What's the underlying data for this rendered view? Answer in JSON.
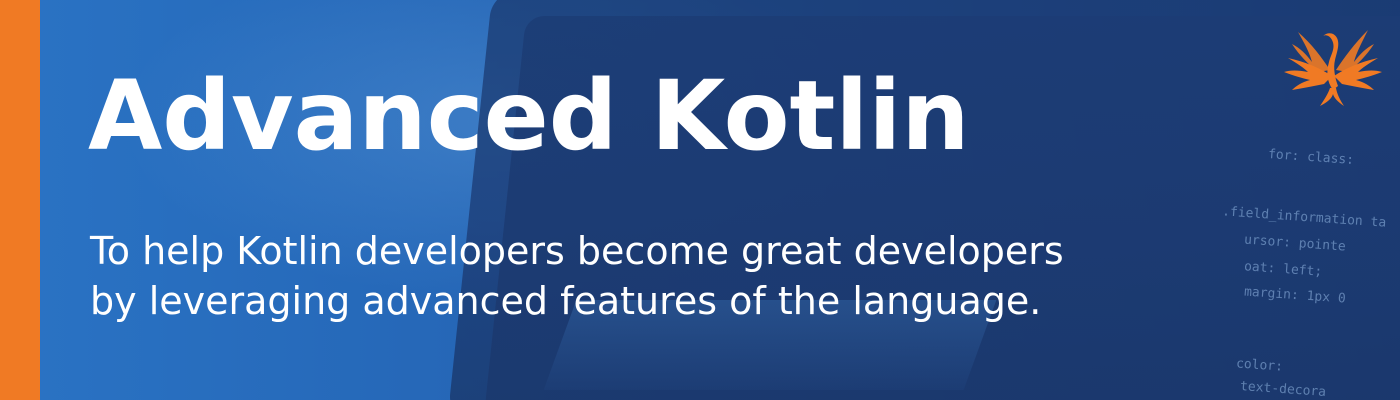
{
  "banner": {
    "title": "Advanced Kotlin",
    "subtitle_line1": "To help Kotlin developers become great developers",
    "subtitle_line2": "by leveraging advanced features of the language.",
    "logo": {
      "icon": "phoenix-logo-icon"
    },
    "background_code": [
      ".field_information ta",
      "ursor: pointe",
      "oat: left;",
      "margin: 1px 0",
      "color:",
      "text-decora",
      "for: class:"
    ]
  },
  "colors": {
    "accent": "#f07a24",
    "background": "#2566b6",
    "text": "#ffffff"
  }
}
